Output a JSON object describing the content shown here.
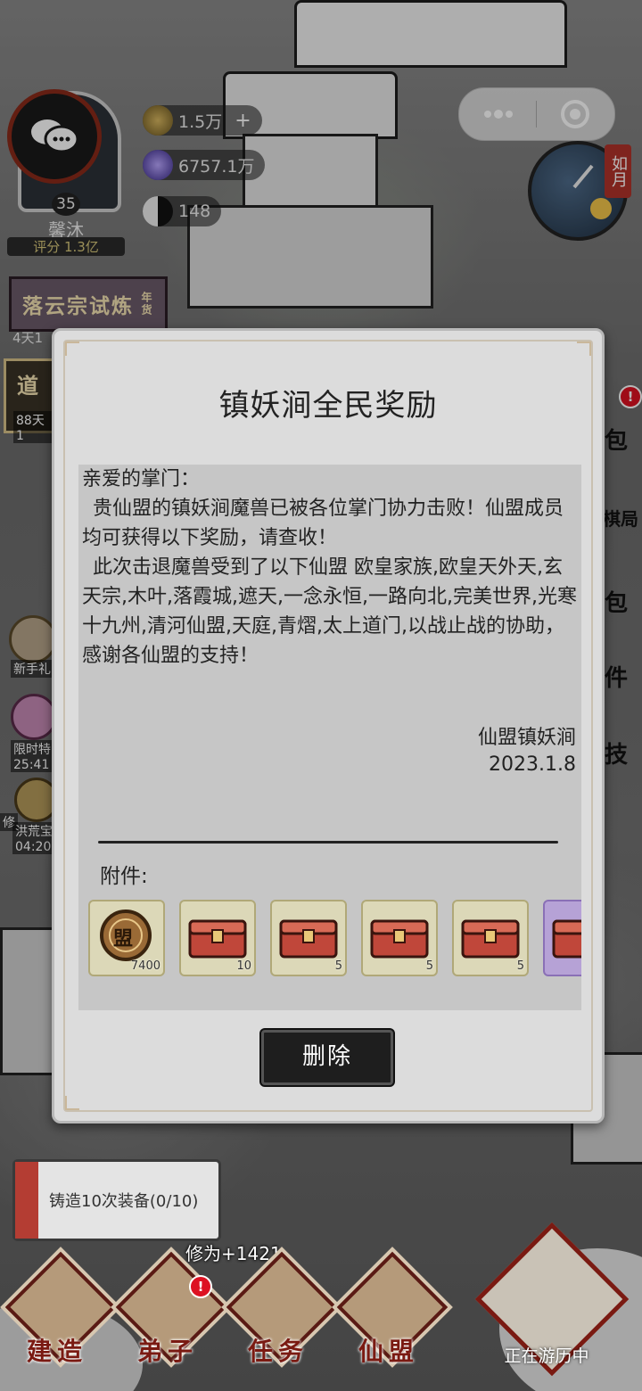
{
  "profile": {
    "level": "35",
    "name": "馨沐",
    "score": "评分 1.3亿"
  },
  "resources": [
    {
      "value": "1.5万",
      "plus": "+"
    },
    {
      "value": "6757.1万"
    },
    {
      "value": "148"
    }
  ],
  "calendar": {
    "month": "如月"
  },
  "event": {
    "title": "落云宗试炼",
    "timer": "4天1",
    "badge": "年货"
  },
  "left_side": {
    "path_label": "道",
    "path_timer": "88天1",
    "newbie": "新手礼",
    "limited": "限时特",
    "limited_timer": "25:41",
    "flood": "洪荒宝",
    "flood_timer": "04:20",
    "cultivate": "修"
  },
  "right_side": [
    "包",
    "棋局",
    "包",
    "件",
    "技"
  ],
  "modal": {
    "title": "镇妖涧全民奖励",
    "greeting": "亲爱的掌门：",
    "paragraph1": "贵仙盟的镇妖涧魔兽已被各位掌门协力击败！仙盟成员均可获得以下奖励，请查收！",
    "paragraph2": "此次击退魔兽受到了以下仙盟 欧皇家族,欧皇天外天,玄天宗,木叶,落霞城,遮天,一念永恒,一路向北,完美世界,光寒十九州,清河仙盟,天庭,青熠,太上道门,以战止战的协助，感谢各仙盟的支持！",
    "signature": "仙盟镇妖涧",
    "date": "2023.1.8",
    "attachments_label": "附件:",
    "attachments": [
      {
        "name": "alliance-coin",
        "qty": "7400",
        "emblem": "盟"
      },
      {
        "name": "treasure-chest",
        "qty": "10"
      },
      {
        "name": "treasure-chest",
        "qty": "5"
      },
      {
        "name": "treasure-chest",
        "qty": "5"
      },
      {
        "name": "treasure-chest",
        "qty": "5"
      },
      {
        "name": "treasure-chest-purple",
        "qty": ""
      }
    ],
    "delete_label": "删除"
  },
  "quest": {
    "text": "铸造10次装备(0/10)"
  },
  "exp_gain": "修为+1421",
  "nav": {
    "build": "建造",
    "disciples": "弟子",
    "tasks": "任务",
    "alliance": "仙盟",
    "travel": "正在游历中",
    "notif": "!"
  },
  "colors": {
    "accent": "#7a1a12",
    "notif": "#dd1122",
    "panel": "#dcdcdc"
  }
}
